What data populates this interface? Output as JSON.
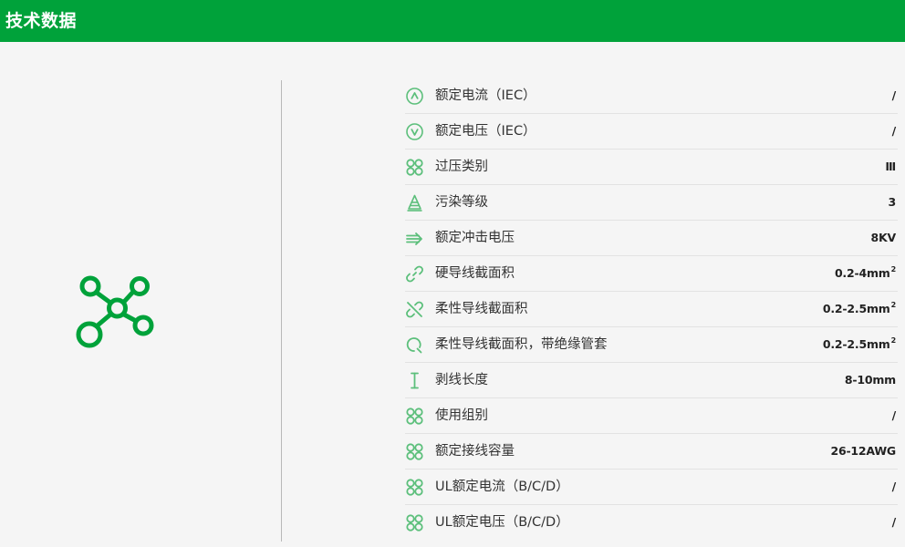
{
  "header": {
    "title": "技术数据"
  },
  "colors": {
    "brand": "#00a23a",
    "icon_light": "#5cbf7b",
    "background": "#f5f5f5"
  },
  "main_icon": {
    "name": "connection-node-icon"
  },
  "specs": [
    {
      "icon": "current-a-circle-icon",
      "label": "额定电流（IEC）",
      "value": "/",
      "sup": ""
    },
    {
      "icon": "voltage-v-circle-icon",
      "label": "额定电压（IEC）",
      "value": "/",
      "sup": ""
    },
    {
      "icon": "four-circles-icon",
      "label": "过压类别",
      "value": "Ⅲ",
      "sup": ""
    },
    {
      "icon": "pollution-cone-icon",
      "label": "污染等级",
      "value": "3",
      "sup": ""
    },
    {
      "icon": "impulse-arrow-icon",
      "label": "额定冲击电压",
      "value": "8KV",
      "sup": ""
    },
    {
      "icon": "link-icon",
      "label": "硬导线截面积",
      "value": "0.2-4mm",
      "sup": "2"
    },
    {
      "icon": "link-broken-icon",
      "label": "柔性导线截面积",
      "value": "0.2-2.5mm",
      "sup": "2"
    },
    {
      "icon": "ferrule-icon",
      "label": "柔性导线截面积，带绝缘管套",
      "value": "0.2-2.5mm",
      "sup": "2"
    },
    {
      "icon": "strip-length-icon",
      "label": "剥线长度",
      "value": "8-10mm",
      "sup": ""
    },
    {
      "icon": "four-circles-icon",
      "label": "使用组别",
      "value": "/",
      "sup": ""
    },
    {
      "icon": "four-circles-icon",
      "label": "额定接线容量",
      "value": "26-12AWG",
      "sup": ""
    },
    {
      "icon": "four-circles-icon",
      "label": "UL额定电流（B/C/D）",
      "value": "/",
      "sup": ""
    },
    {
      "icon": "four-circles-icon",
      "label": "UL额定电压（B/C/D）",
      "value": "/",
      "sup": ""
    }
  ]
}
